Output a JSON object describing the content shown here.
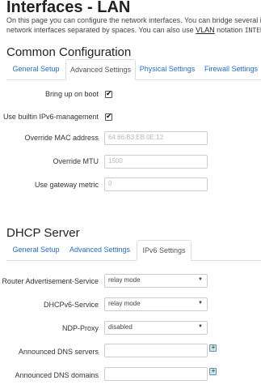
{
  "page": {
    "title": "Interfaces - LAN",
    "intro_line1": "On this page you can configure the network interfaces. You can bridge several interfaces b",
    "intro_line2a": "network interfaces separated by spaces. You can also use ",
    "intro_vlan": "VLAN",
    "intro_line2b": " notation ",
    "intro_mono": "INTERFACE.VLA"
  },
  "common": {
    "title": "Common Configuration",
    "tabs": [
      "General Setup",
      "Advanced Settings",
      "Physical Settings",
      "Firewall Settings"
    ],
    "active_tab": "Advanced Settings",
    "fields": {
      "bring_up_on_boot": {
        "label": "Bring up on boot",
        "checked": true
      },
      "ipv6_management": {
        "label": "Use builtin IPv6-management",
        "checked": true
      },
      "mac": {
        "label": "Override MAC address",
        "placeholder": "64:66:B3:EB:0E:12"
      },
      "mtu": {
        "label": "Override MTU",
        "placeholder": "1500"
      },
      "metric": {
        "label": "Use gateway metric",
        "placeholder": "0"
      }
    }
  },
  "dhcp": {
    "title": "DHCP Server",
    "tabs": [
      "General Setup",
      "Advanced Settings",
      "IPv6 Settings"
    ],
    "active_tab": "IPv6 Settings",
    "fields": {
      "ra_service": {
        "label": "Router Advertisement-Service",
        "value": "relay mode"
      },
      "dhcpv6": {
        "label": "DHCPv6-Service",
        "value": "relay mode"
      },
      "ndp": {
        "label": "NDP-Proxy",
        "value": "disabled"
      },
      "dns_servers": {
        "label": "Announced DNS servers",
        "value": ""
      },
      "dns_domains": {
        "label": "Announced DNS domains",
        "value": ""
      }
    }
  },
  "glyphs": {
    "check": "✔",
    "caret": "▼"
  },
  "icons": {
    "add": "add-icon"
  },
  "colors": {
    "link": "#2a6ebb",
    "border": "#dddddd"
  }
}
